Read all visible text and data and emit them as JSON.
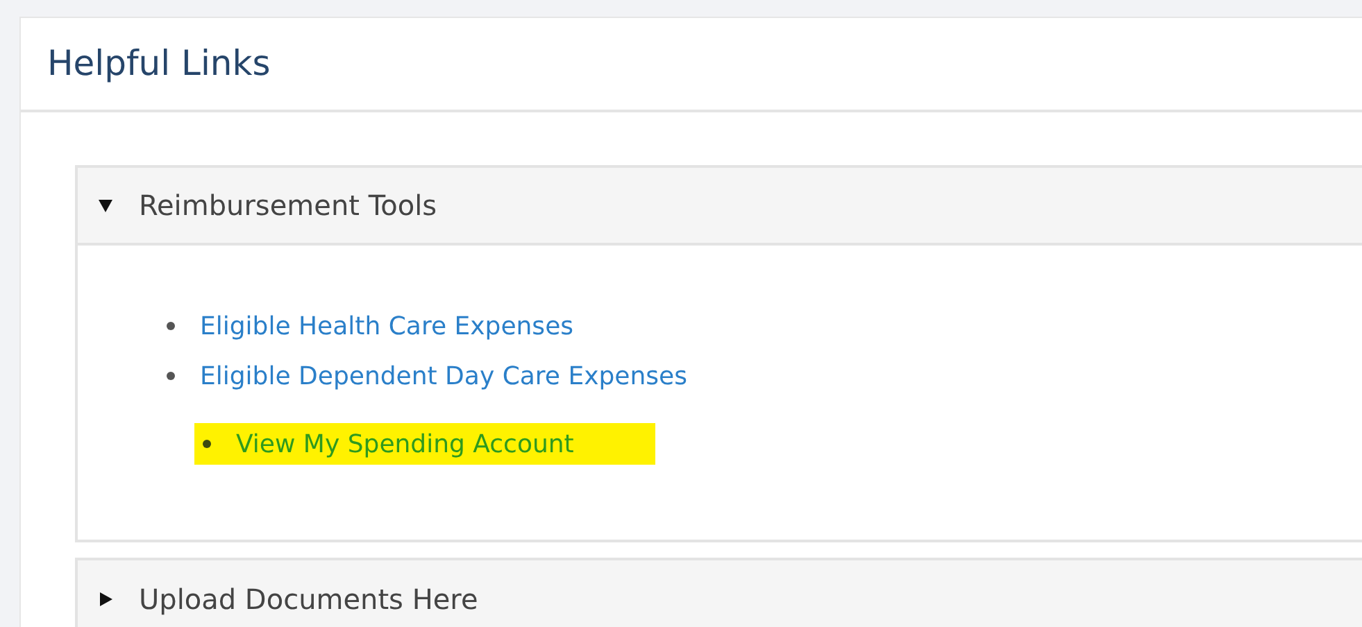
{
  "card": {
    "title": "Helpful Links"
  },
  "panels": [
    {
      "title": "Reimbursement Tools",
      "expanded": true,
      "links": [
        {
          "label": "Eligible Health Care Expenses",
          "highlighted": false
        },
        {
          "label": "Eligible Dependent Day Care Expenses",
          "highlighted": false
        },
        {
          "label": "View My Spending Account",
          "highlighted": true
        }
      ]
    },
    {
      "title": "Upload Documents Here",
      "expanded": false
    }
  ]
}
